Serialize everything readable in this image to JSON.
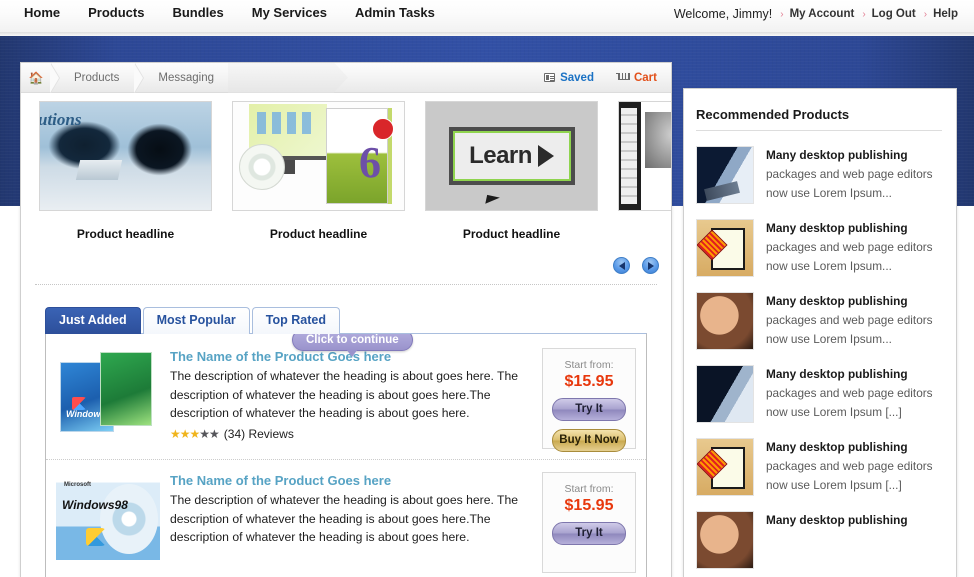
{
  "topnav": {
    "items": [
      {
        "label": "Home"
      },
      {
        "label": "Products"
      },
      {
        "label": "Bundles"
      },
      {
        "label": "My Services"
      },
      {
        "label": "Admin Tasks"
      }
    ],
    "welcome": "Welcome, Jimmy!",
    "chevron": "›",
    "account_links": [
      {
        "label": "My Account"
      },
      {
        "label": "Log Out"
      },
      {
        "label": "Help"
      }
    ]
  },
  "breadcrumb": {
    "home_icon": "home-icon",
    "items": [
      {
        "label": "Products"
      },
      {
        "label": "Messaging"
      }
    ],
    "saved_label": "Saved",
    "cart_label": "Cart"
  },
  "carousel": {
    "slides": [
      {
        "caption": "Product headline",
        "art": "office-meeting"
      },
      {
        "caption": "Product headline",
        "art": "smartdraw-box"
      },
      {
        "caption": "Product headline",
        "art": "learn-button"
      },
      {
        "caption": "",
        "art": "photoshop-box"
      }
    ],
    "prev_label": "◀",
    "next_label": "▶"
  },
  "tabs": [
    {
      "label": "Just Added",
      "active": true
    },
    {
      "label": "Most Popular",
      "active": false
    },
    {
      "label": "Top Rated",
      "active": false
    }
  ],
  "tooltip": {
    "text": "Click to continue"
  },
  "products": [
    {
      "title": "The Name of the Product Goes here",
      "description": "The description of whatever the heading is about goes here. The description of whatever the heading is about goes here.The description of whatever the heading is about goes here.",
      "stars_filled": 3,
      "stars_empty": 2,
      "reviews": "(34) Reviews",
      "start_from": "Start from:",
      "price": "$15.95",
      "try_label": "Try It",
      "buy_label": "Buy It Now",
      "art": "windows-xp"
    },
    {
      "title": "The Name of the Product Goes here",
      "description": "The description of whatever the heading is about goes here. The description of whatever the heading is about goes here.The description of whatever the heading is about goes here.",
      "start_from": "Start from:",
      "price": "$15.95",
      "try_label": "Try It",
      "art": "windows-98"
    }
  ],
  "sidebar": {
    "title": "Recommended Products",
    "items": [
      {
        "heading": "Many desktop publishing",
        "line2": "packages and web page editors",
        "line3": "now use Lorem Ipsum...",
        "art": "hand-tablet"
      },
      {
        "heading": "Many desktop publishing",
        "line2": "packages and web page editors",
        "line3": "now use Lorem Ipsum...",
        "art": "document-icon"
      },
      {
        "heading": "Many desktop publishing",
        "line2": "packages and web page editors",
        "line3": "now use Lorem Ipsum...",
        "art": "face-photo"
      },
      {
        "heading": "Many desktop publishing",
        "line2": "packages and web page editors",
        "line3": "now use Lorem Ipsum [...]",
        "art": "hand-tablet"
      },
      {
        "heading": "Many desktop publishing",
        "line2": "packages and web page editors",
        "line3": "now use Lorem Ipsum [...]",
        "art": "document-icon"
      },
      {
        "heading": "Many desktop publishing",
        "line2": "",
        "line3": "",
        "art": "face-photo"
      }
    ]
  },
  "colors": {
    "band_blue": "#2d4896",
    "tab_active": "#2d4f9a",
    "price_red": "#e8380d",
    "saved_blue": "#1b72c4",
    "cart_orange": "#e2501a",
    "title_teal": "#57a3c4",
    "tooltip_purple": "#9a93cc"
  }
}
